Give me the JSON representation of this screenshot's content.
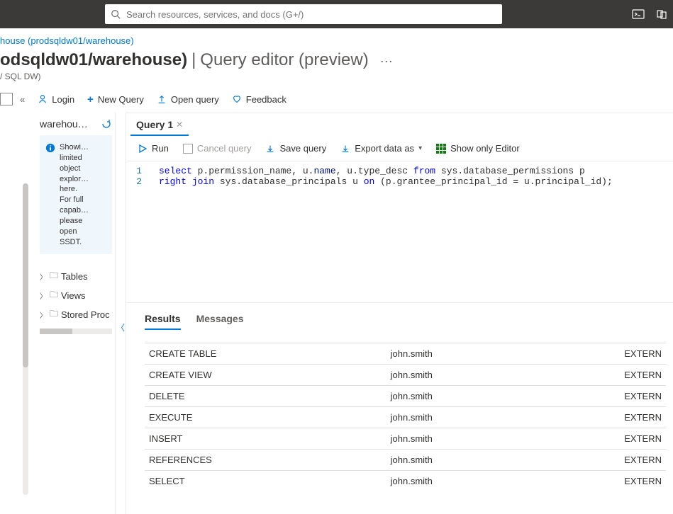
{
  "top": {
    "search_placeholder": "Search resources, services, and docs (G+/)"
  },
  "breadcrumb": {
    "link": "house (prodsqldw01/warehouse)"
  },
  "page": {
    "title": "odsqldw01/warehouse)",
    "divider": " | ",
    "section": "Query editor (preview)",
    "subtitle": "/ SQL DW)"
  },
  "toolbar": {
    "login": "Login",
    "new_query": "New Query",
    "open_query": "Open query",
    "feedback": "Feedback"
  },
  "sidebar": {
    "title": "warehou…",
    "info": "Showi…\nlimited\nobject\nexplor…\nhere.\nFor full\ncapab…\nplease\nopen\nSSDT.",
    "tree": [
      "Tables",
      "Views",
      "Stored Proc"
    ]
  },
  "editor": {
    "tab": "Query 1",
    "actions": {
      "run": "Run",
      "cancel": "Cancel query",
      "save": "Save query",
      "export": "Export data as",
      "toggle": "Show only Editor"
    },
    "code": {
      "lines": [
        {
          "n": "1",
          "raw": "select p.permission_name, u.name, u.type_desc from sys.database_permissions p"
        },
        {
          "n": "2",
          "raw": "right join sys.database_principals u on (p.grantee_principal_id = u.principal_id);"
        }
      ]
    }
  },
  "results": {
    "tabs": {
      "results": "Results",
      "messages": "Messages"
    },
    "rows": [
      {
        "perm": "CREATE TABLE",
        "user": "john.smith",
        "type": "EXTERN"
      },
      {
        "perm": "CREATE VIEW",
        "user": "john.smith",
        "type": "EXTERN"
      },
      {
        "perm": "DELETE",
        "user": "john.smith",
        "type": "EXTERN"
      },
      {
        "perm": "EXECUTE",
        "user": "john.smith",
        "type": "EXTERN"
      },
      {
        "perm": "INSERT",
        "user": "john.smith",
        "type": "EXTERN"
      },
      {
        "perm": "REFERENCES",
        "user": "john.smith",
        "type": "EXTERN"
      },
      {
        "perm": "SELECT",
        "user": "john.smith",
        "type": "EXTERN"
      }
    ]
  }
}
